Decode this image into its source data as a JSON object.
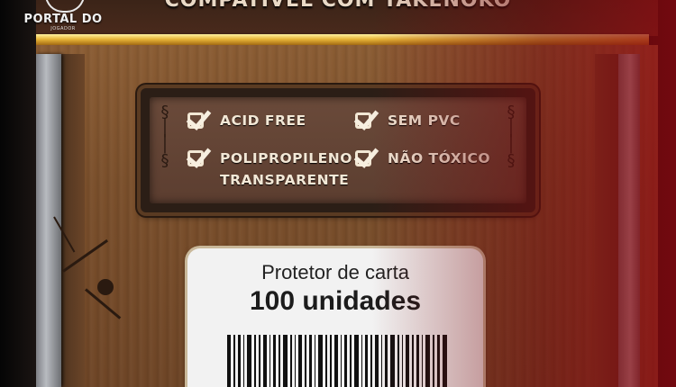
{
  "banner": {
    "title": "COMPATÍVEL COM TAKENOKO"
  },
  "logo": {
    "name": "PORTAL DO",
    "sub": "JOGADOR"
  },
  "features": [
    {
      "label": "ACID FREE",
      "icon": "checkbox-checked-icon"
    },
    {
      "label": "SEM PVC",
      "icon": "checkbox-checked-icon"
    },
    {
      "label": "POLIPROPILENO TRANSPARENTE",
      "label_line1": "POLIPROPILENO",
      "label_line2": "TRANSPARENTE",
      "icon": "checkbox-checked-icon"
    },
    {
      "label": "NÃO TÓXICO",
      "icon": "checkbox-checked-icon"
    }
  ],
  "card": {
    "line1": "Protetor de carta",
    "line2": "100 unidades"
  },
  "colors": {
    "accent_red": "#9a0a12",
    "gold": "#e9b73a",
    "wood": "#7a4f2b"
  }
}
